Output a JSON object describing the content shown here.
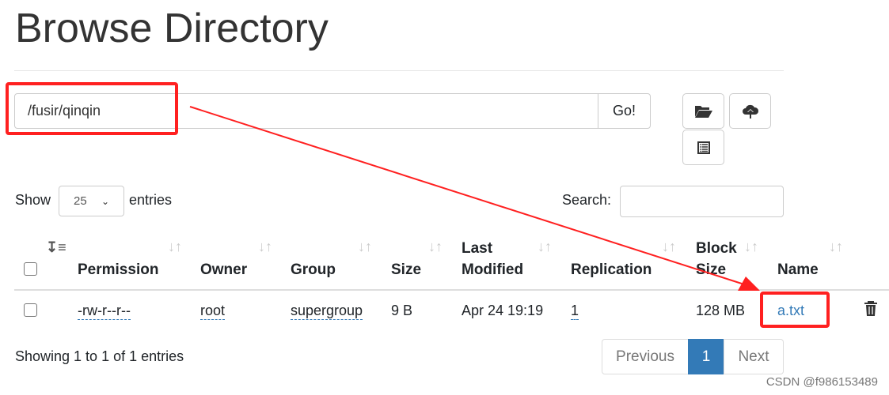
{
  "title": "Browse Directory",
  "path_value": "/fusir/qinqin",
  "go_label": "Go!",
  "toolbar": {
    "icons": [
      "folder-open-icon",
      "cloud-upload-icon",
      "list-icon"
    ]
  },
  "show_label": "Show",
  "entries_value": "25",
  "entries_label": "entries",
  "search_label": "Search:",
  "columns": [
    "Permission",
    "Owner",
    "Group",
    "Size",
    "Last",
    "Modified",
    "Replication",
    "Block",
    "Size",
    "Name"
  ],
  "rows": [
    {
      "permission": "-rw-r--r--",
      "owner": "root",
      "group": "supergroup",
      "size": "9 B",
      "last_modified": "Apr 24 19:19",
      "replication": "1",
      "block_size": "128 MB",
      "name": "a.txt"
    }
  ],
  "footer": "Showing 1 to 1 of 1 entries",
  "pagination": {
    "previous": "Previous",
    "current": "1",
    "next": "Next"
  },
  "watermark": "CSDN @f986153489",
  "colors": {
    "link": "#337ab7",
    "annotation": "#ff2020",
    "active_page": "#337ab7"
  }
}
